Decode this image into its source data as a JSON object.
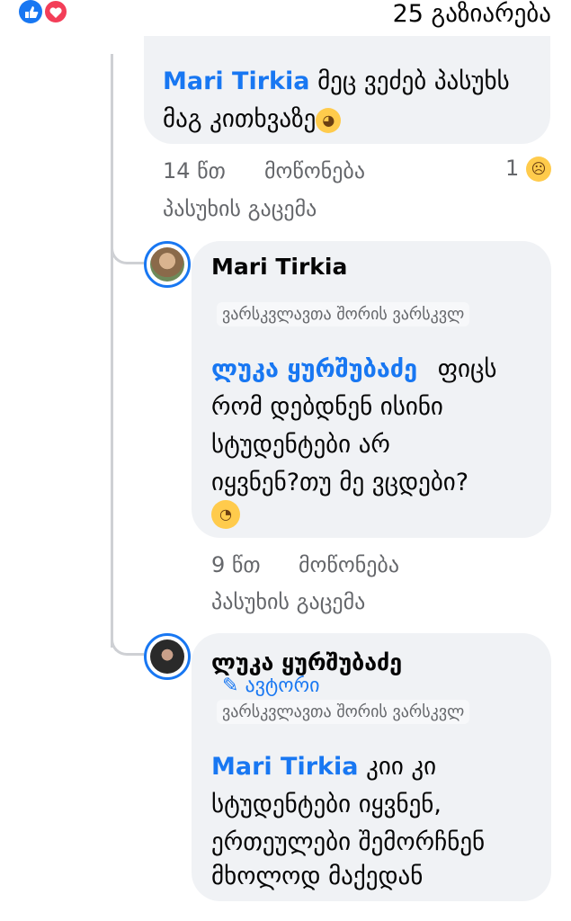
{
  "header": {
    "shares": "25 გაზიარება"
  },
  "reply1": {
    "mention": "Mari Tirkia",
    "text_line1": "მეც ვეძებ პასუხს",
    "text_line2": "მაგ კითხვაზე",
    "time": "14 წთ",
    "like": "მოწონება",
    "reply": "პასუხის გაცემა",
    "reaction_count": "1"
  },
  "reply2": {
    "name": "Mari Tirkia",
    "badge": "ვარსკვლავთა შორის ვარსკვლ",
    "mention": "ლუკა ყურშუბაძე",
    "lines": [
      "ფიცს",
      "რომ დებდნენ ისინი",
      "სტუდენტები არ",
      "იყვნენ?თუ მე ვცდები?"
    ],
    "time": "9 წთ",
    "like": "მოწონება",
    "reply": "პასუხის გაცემა"
  },
  "reply3": {
    "name": "ლუკა ყურშუბაძე",
    "author": "ავტორი",
    "badge": "ვარსკვლავთა შორის ვარსკვლ",
    "mention": "Mari Tirkia",
    "lines": [
      "კიი კი",
      "სტუდენტები იყვნენ,",
      "ერთეულები შემორჩნენ",
      "მხოლოდ მაქედან"
    ]
  },
  "colors": {
    "accent": "#1877f2",
    "bubble": "#f0f2f5",
    "meta": "#65676b"
  }
}
